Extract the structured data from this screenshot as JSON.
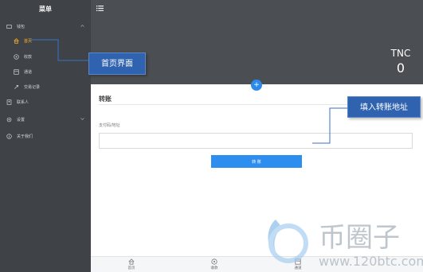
{
  "sidebar": {
    "title": "菜单",
    "items": [
      {
        "label": "钱包",
        "icon": "wallet-icon"
      },
      {
        "label": "首页",
        "icon": "home-icon",
        "active": true
      },
      {
        "label": "收款",
        "icon": "receive-icon"
      },
      {
        "label": "通道",
        "icon": "channel-icon"
      },
      {
        "label": "交易记录",
        "icon": "records-icon"
      },
      {
        "label": "联系人",
        "icon": "contacts-icon"
      },
      {
        "label": "设置",
        "icon": "settings-icon"
      },
      {
        "label": "关于我们",
        "icon": "about-icon"
      }
    ]
  },
  "header": {
    "currency": "TNC",
    "balance": "0",
    "plus": "+"
  },
  "main": {
    "title": "转账",
    "address_label": "支付码/地址",
    "address_value": "",
    "transfer_button": "转 账"
  },
  "tabbar": {
    "tabs": [
      {
        "label": "首页",
        "icon": "home-icon"
      },
      {
        "label": "收款",
        "icon": "receive-icon"
      },
      {
        "label": "通道",
        "icon": "channel-icon"
      }
    ]
  },
  "annotations": {
    "home_callout": "首页界面",
    "address_callout": "填入转账地址"
  },
  "watermark": {
    "text": "币圈子",
    "url": "www.120btc.com"
  },
  "colors": {
    "sidebar_bg": "#3f4347",
    "header_bg": "#4b4e52",
    "accent": "#2d8ef0",
    "active_nav": "#ffb22a",
    "callout_bg": "#2f63b0"
  }
}
